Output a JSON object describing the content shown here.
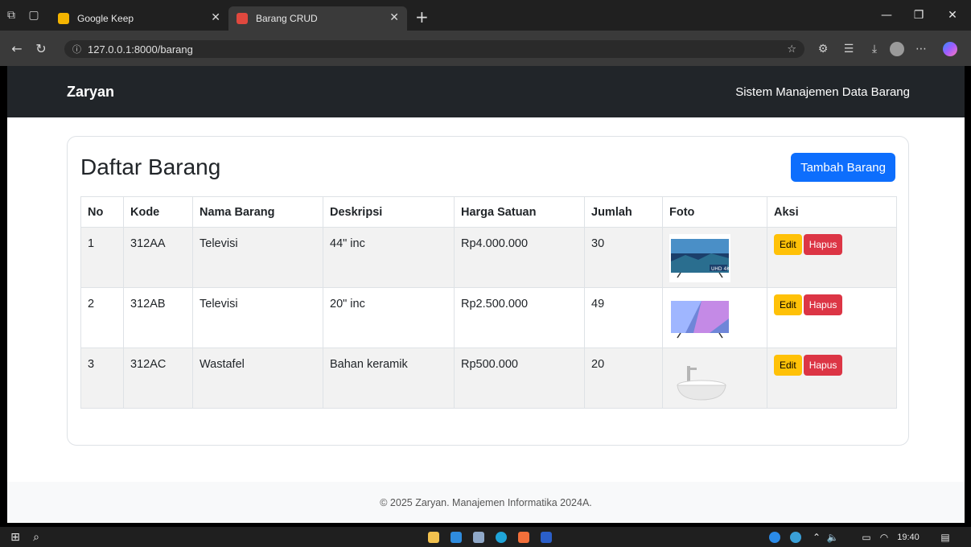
{
  "browser": {
    "tabs": [
      {
        "label": "Google Keep",
        "active": false,
        "favicon_color": "#f4b400"
      },
      {
        "label": "Barang CRUD",
        "active": true,
        "favicon_color": "#e0483e"
      }
    ],
    "url": "127.0.0.1:8000/barang"
  },
  "navbar": {
    "brand": "Zaryan",
    "subtitle": "Sistem Manajemen Data Barang"
  },
  "card": {
    "title": "Daftar Barang",
    "add_button": "Tambah Barang"
  },
  "table": {
    "headers": [
      "No",
      "Kode",
      "Nama Barang",
      "Deskripsi",
      "Harga Satuan",
      "Jumlah",
      "Foto",
      "Aksi"
    ],
    "rows": [
      {
        "no": "1",
        "kode": "312AA",
        "nama": "Televisi",
        "deskripsi": "44\" inc",
        "harga": "Rp4.000.000",
        "jumlah": "30",
        "foto": "tv-icon"
      },
      {
        "no": "2",
        "kode": "312AB",
        "nama": "Televisi",
        "deskripsi": "20\" inc",
        "harga": "Rp2.500.000",
        "jumlah": "49",
        "foto": "tv-icon"
      },
      {
        "no": "3",
        "kode": "312AC",
        "nama": "Wastafel",
        "deskripsi": "Bahan keramik",
        "harga": "Rp500.000",
        "jumlah": "20",
        "foto": "sink-icon"
      }
    ],
    "edit_label": "Edit",
    "delete_label": "Hapus"
  },
  "footer": {
    "text": "© 2025 Zaryan. Manajemen Informatika 2024A."
  },
  "taskbar": {
    "time": "19:40"
  },
  "colors": {
    "primary": "#0d6efd",
    "warning": "#ffc107",
    "danger": "#dc3545",
    "navbar": "#212529"
  }
}
